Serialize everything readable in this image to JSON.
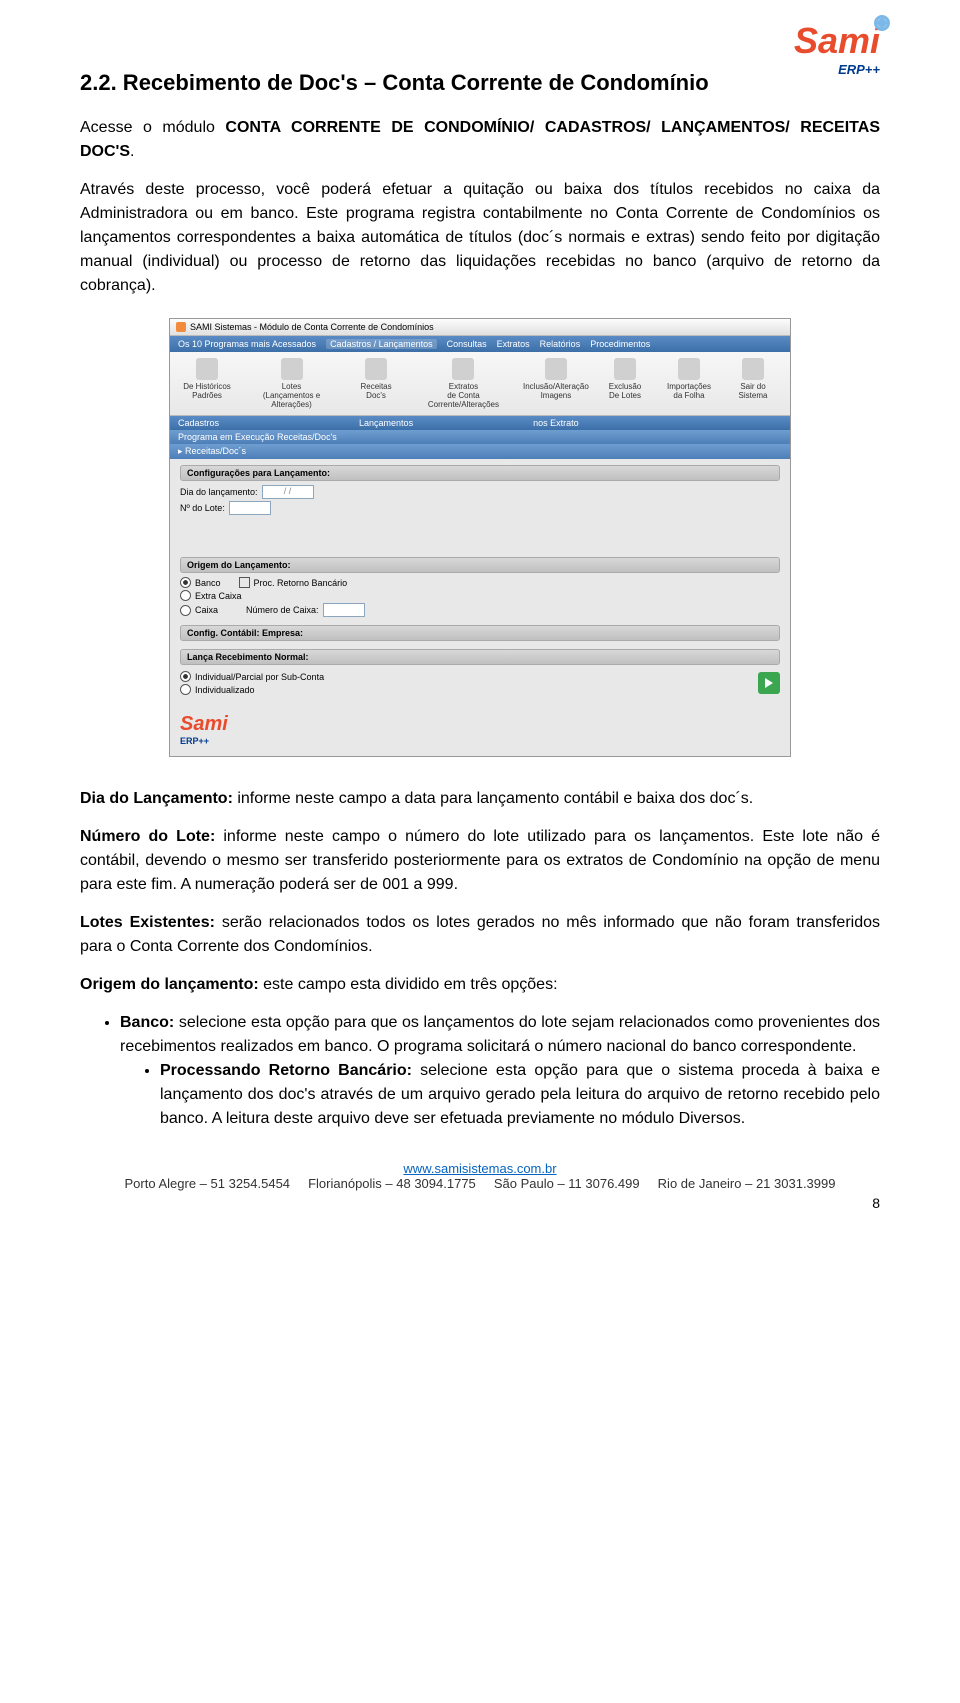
{
  "logo": {
    "brand": "Sami",
    "sub": "ERP++"
  },
  "heading": "2.2. Recebimento de Doc's – Conta Corrente de Condomínio",
  "p1": "Acesse o módulo CONTA CORRENTE DE CONDOMÍNIO/ CADASTROS/ LANÇAMENTOS/ RECEITAS DOC'S.",
  "p1_prefix": "Acesse o módulo ",
  "p1_bold": "CONTA CORRENTE DE CONDOMÍNIO/ CADASTROS/ LANÇAMENTOS/ RECEITAS DOC'S",
  "p1_suffix": ".",
  "p2": "Através deste processo, você poderá efetuar a quitação ou baixa dos títulos recebidos no caixa da Administradora ou em banco. Este programa registra contabilmente no Conta Corrente de Condomínios os lançamentos correspondentes a baixa automática de títulos (doc´s normais e extras) sendo feito por digitação manual (individual) ou processo de retorno das liquidações recebidas no banco (arquivo de retorno da cobrança).",
  "screenshot": {
    "title": "SAMI Sistemas - Módulo de Conta Corrente de Condomínios",
    "tabs": [
      "Os 10 Programas mais Acessados",
      "Cadastros / Lançamentos",
      "Consultas",
      "Extratos",
      "Relatórios",
      "Procedimentos"
    ],
    "toolbar": [
      {
        "l1": "De Históricos",
        "l2": "Padrões"
      },
      {
        "l1": "Lotes",
        "l2": "(Lançamentos e Alterações)"
      },
      {
        "l1": "Receitas",
        "l2": "Doc's"
      },
      {
        "l1": "Extratos",
        "l2": "de Conta Corrente/Alterações"
      },
      {
        "l1": "Inclusão/Alteração",
        "l2": "Imagens"
      },
      {
        "l1": "Exclusão",
        "l2": "De Lotes"
      },
      {
        "l1": "Importações",
        "l2": "da Folha"
      },
      {
        "l1": "Sair do",
        "l2": "Sistema"
      }
    ],
    "subbar_groups": [
      "Cadastros",
      "Lançamentos",
      "nos Extrato"
    ],
    "progbar": "Programa em Execução  Receitas/Doc's",
    "breadcrumb": "Receitas/Doc´s",
    "group1_title": "Configurações para Lançamento:",
    "field_dia": "Dia do lançamento:",
    "field_dia_mask": "/  /",
    "field_lote": "Nº do Lote:",
    "group2_title": "Origem do Lançamento:",
    "opt_banco": "Banco",
    "opt_proc": "Proc. Retorno Bancário",
    "opt_extra": "Extra Caixa",
    "opt_caixa": "Caixa",
    "num_caixa": "Número de Caixa:",
    "config_contabil": "Config. Contábil: Empresa:",
    "group3_title": "Lança Recebimento Normal:",
    "opt_ind_parc": "Individual/Parcial por Sub-Conta",
    "opt_ind": "Individualizado"
  },
  "p3_label": "Dia do Lançamento:",
  "p3_text": " informe neste campo a data para lançamento contábil e baixa dos doc´s.",
  "p4_label": "Número do Lote:",
  "p4_text": " informe neste campo o número do lote utilizado para os lançamentos. Este lote não é contábil, devendo o mesmo ser transferido posteriormente para os extratos de Condomínio na opção de menu para este fim. A numeração poderá ser de 001 a 999.",
  "p5_label": "Lotes Existentes:",
  "p5_text": " serão relacionados todos os lotes gerados no mês informado que não foram transferidos para o Conta Corrente dos Condomínios.",
  "p6_label": "Origem do lançamento:",
  "p6_text": " este campo esta dividido em três opções:",
  "bullet1_label": "Banco:",
  "bullet1_text": " selecione esta opção para que os lançamentos do lote sejam relacionados como provenientes dos recebimentos realizados em banco. O programa solicitará o número nacional do banco correspondente.",
  "bullet2_label": "Processando Retorno Bancário:",
  "bullet2_text": " selecione esta opção para que o sistema proceda à baixa e lançamento dos doc's através de um arquivo gerado pela leitura do arquivo de retorno recebido pelo banco. A leitura deste arquivo deve ser efetuada previamente no módulo Diversos.",
  "footer_url": "www.samisistemas.com.br",
  "footer_contacts": "Porto Alegre – 51 3254.5454     Florianópolis – 48 3094.1775     São Paulo – 11 3076.499     Rio de Janeiro – 21 3031.3999",
  "page_num": "8"
}
